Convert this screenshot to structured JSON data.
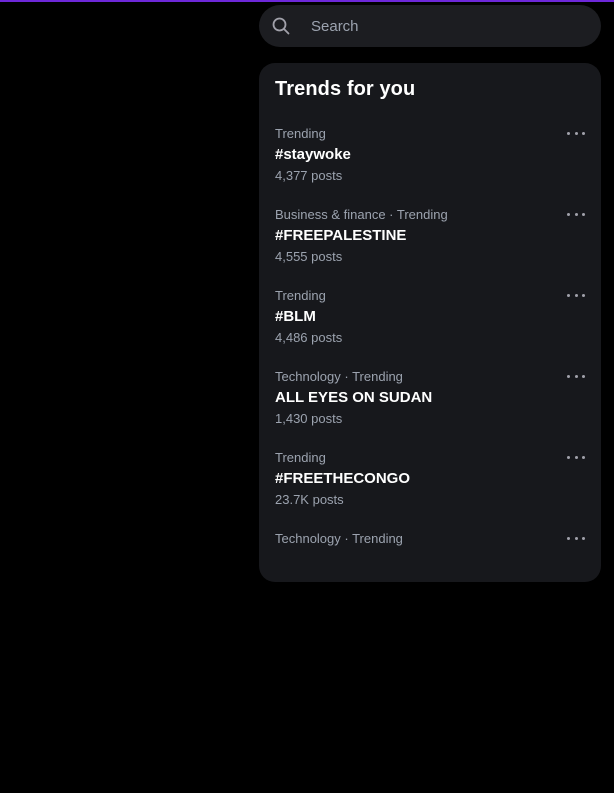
{
  "search": {
    "placeholder": "Search",
    "icon": "search-icon"
  },
  "trends": {
    "title": "Trends for you",
    "items": [
      {
        "category": "Trending",
        "name": "#staywoke",
        "count": "4,377 posts"
      },
      {
        "category": "Business & finance · Trending",
        "name": "#FREEPALESTINE",
        "count": "4,555 posts"
      },
      {
        "category": "Trending",
        "name": "#BLM",
        "count": "4,486 posts"
      },
      {
        "category": "Technology · Trending",
        "name": "ALL EYES ON SUDAN",
        "count": "1,430 posts"
      },
      {
        "category": "Trending",
        "name": "#FREETHECONGO",
        "count": "23.7K posts"
      },
      {
        "category": "Technology · Trending",
        "name": "",
        "count": ""
      }
    ]
  },
  "colors": {
    "background": "#000000",
    "panel": "#17181c",
    "search_bg": "#1c1d21",
    "muted_text": "#9ca3af",
    "accent_line": "#6d28d9"
  }
}
